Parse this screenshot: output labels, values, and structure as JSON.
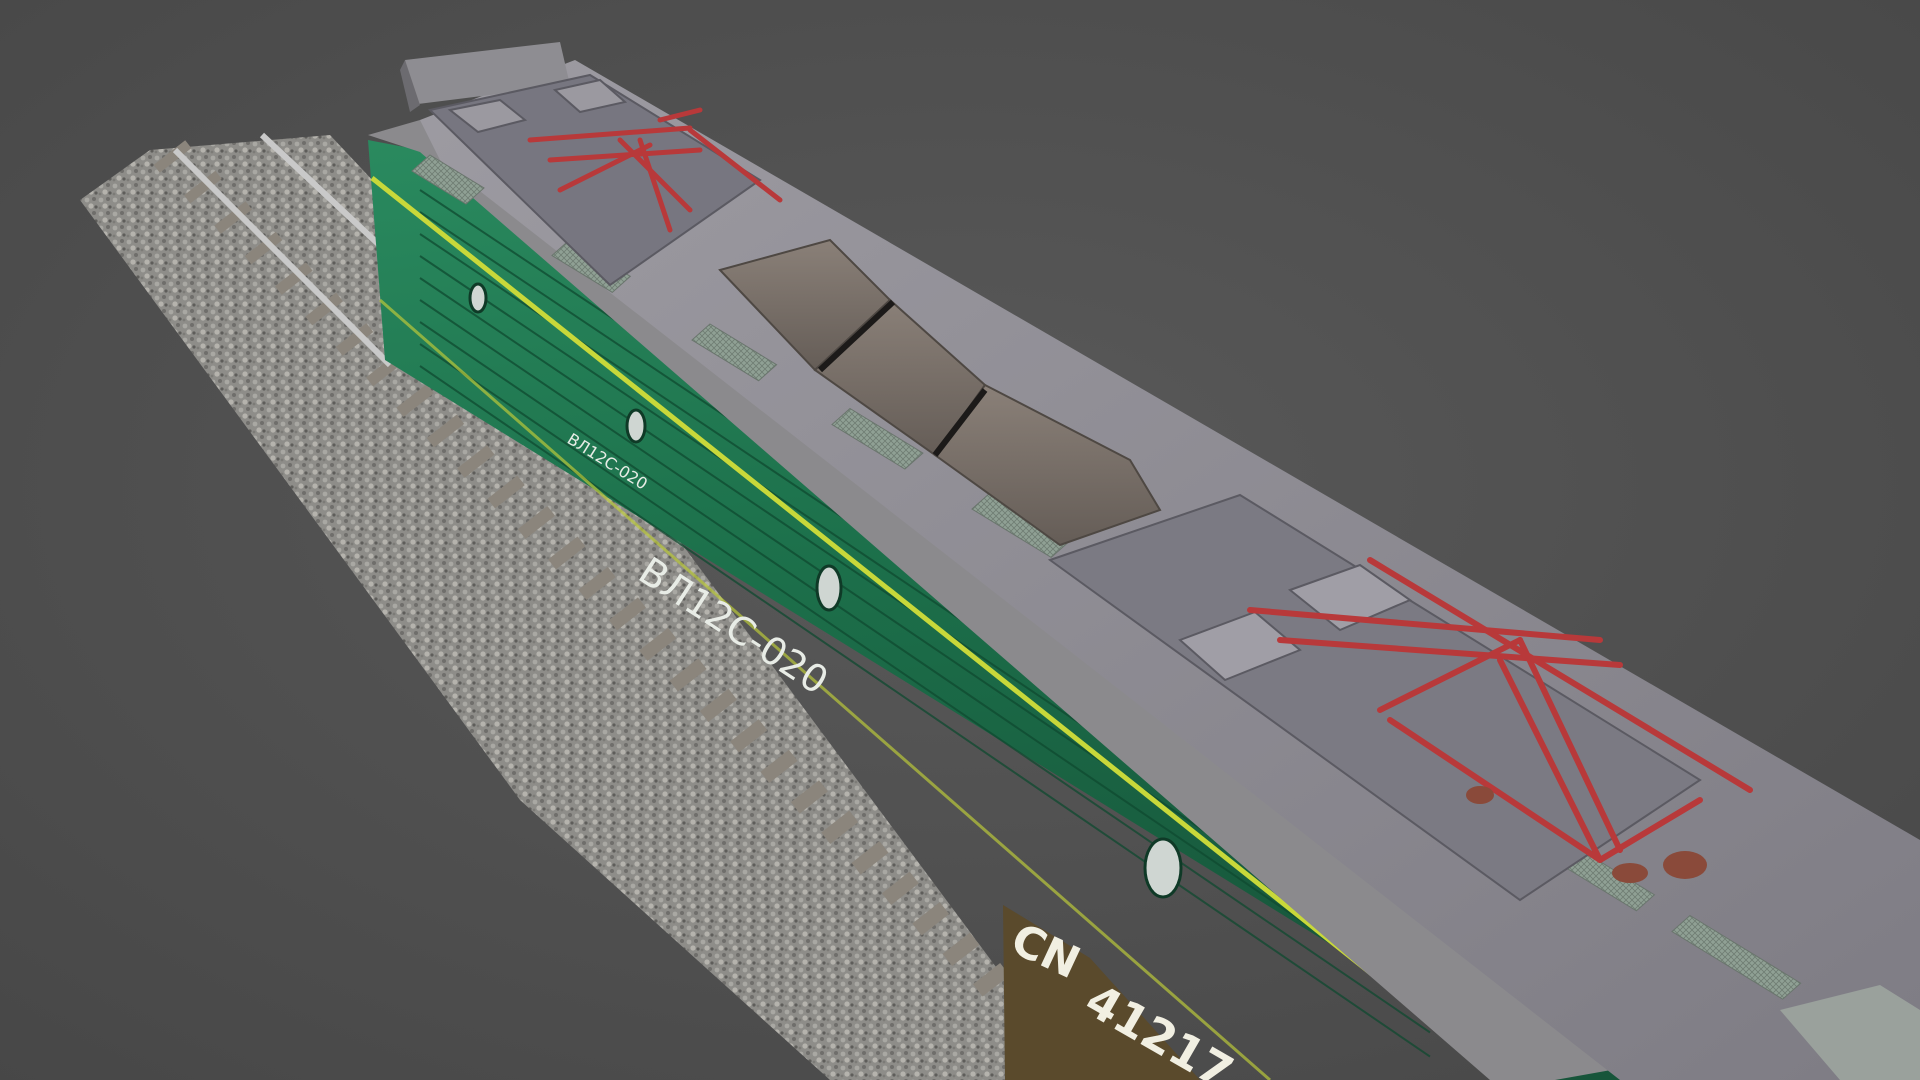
{
  "scene": {
    "subject": "3D render of a green electric locomotive on a short piece of railway track",
    "background_color": "#505050",
    "body_color": "#1f7a52",
    "roof_color": "#8c8a90",
    "pantograph_color": "#b8393a",
    "stripe_color": "#c8d83a",
    "ballast_color": "#8e8e8a"
  },
  "markings": {
    "side_number": "ВЛ12С-020",
    "small_number": "ВЛ12С-020",
    "plate_prefix": "CN",
    "plate_number": "41217"
  }
}
